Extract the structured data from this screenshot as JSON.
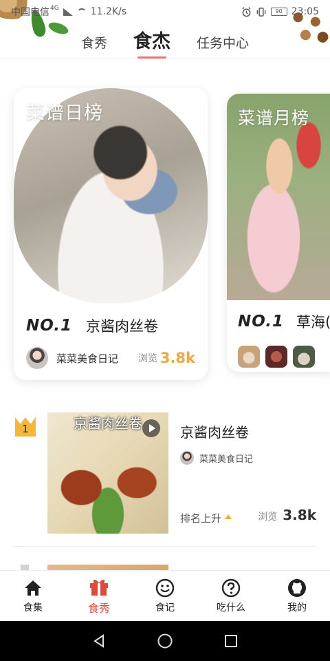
{
  "status_bar": {
    "carrier": "中国电信",
    "network": "4G",
    "speed": "11.2K/s",
    "battery": "90",
    "time": "23:05"
  },
  "top_tabs": [
    {
      "label": "食秀",
      "active": false
    },
    {
      "label": "食杰",
      "active": true
    },
    {
      "label": "任务中心",
      "active": false
    }
  ],
  "rank_cards": [
    {
      "label": "菜谱日榜",
      "rank": "NO.1",
      "dish": "京酱肉丝卷",
      "author": "菜菜美食日记",
      "views_label": "浏览",
      "views": "3.8k"
    },
    {
      "label": "菜谱月榜",
      "rank": "NO.1",
      "dish": "草海(",
      "thumb_colors": [
        "#c9a27a",
        "#8a3d3d",
        "#7f8a6a"
      ]
    }
  ],
  "list": [
    {
      "rank": "1",
      "photo_caption": "京酱肉丝卷",
      "title": "京酱肉丝卷",
      "author": "菜菜美食日记",
      "rank_change": "排名上升",
      "views_label": "浏览",
      "views": "3.8k"
    }
  ],
  "bottom_nav": [
    {
      "label": "食集",
      "icon": "home-icon",
      "active": false
    },
    {
      "label": "食秀",
      "icon": "gift-icon",
      "active": true
    },
    {
      "label": "食记",
      "icon": "smile-icon",
      "active": false
    },
    {
      "label": "吃什么",
      "icon": "question-icon",
      "active": false
    },
    {
      "label": "我的",
      "icon": "github-icon",
      "active": false
    }
  ],
  "colors": {
    "accent": "#e04a3a",
    "tab_underline": "#e9787a",
    "highlight_yellow": "#f4c443",
    "views_orange": "#f2a93b",
    "crown_gold": "#f6b63e"
  }
}
